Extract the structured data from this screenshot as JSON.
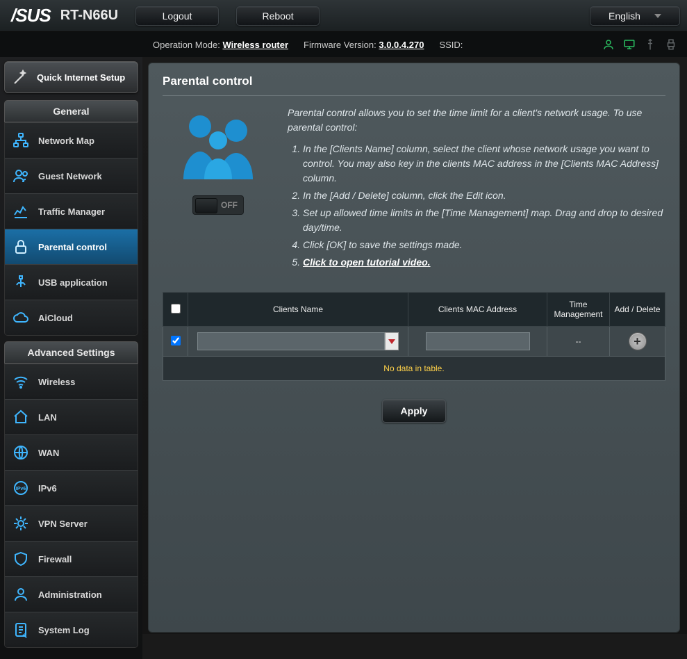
{
  "header": {
    "brand": "/SUS",
    "model": "RT-N66U",
    "logout": "Logout",
    "reboot": "Reboot",
    "language": "English"
  },
  "statusbar": {
    "opmode_label": "Operation Mode:",
    "opmode_value": "Wireless router",
    "fw_label": "Firmware Version:",
    "fw_value": "3.0.0.4.270",
    "ssid_label": "SSID:"
  },
  "sidebar": {
    "qis": "Quick Internet Setup",
    "general_header": "General",
    "general_items": [
      {
        "label": "Network Map",
        "icon": "network-map"
      },
      {
        "label": "Guest Network",
        "icon": "guest"
      },
      {
        "label": "Traffic Manager",
        "icon": "traffic"
      },
      {
        "label": "Parental control",
        "icon": "lock",
        "active": true
      },
      {
        "label": "USB application",
        "icon": "usb"
      },
      {
        "label": "AiCloud",
        "icon": "cloud"
      }
    ],
    "advanced_header": "Advanced Settings",
    "advanced_items": [
      {
        "label": "Wireless",
        "icon": "wifi"
      },
      {
        "label": "LAN",
        "icon": "home"
      },
      {
        "label": "WAN",
        "icon": "globe"
      },
      {
        "label": "IPv6",
        "icon": "ipv6"
      },
      {
        "label": "VPN Server",
        "icon": "vpn"
      },
      {
        "label": "Firewall",
        "icon": "shield"
      },
      {
        "label": "Administration",
        "icon": "admin"
      },
      {
        "label": "System Log",
        "icon": "log"
      }
    ]
  },
  "panel": {
    "title": "Parental control",
    "lead": "Parental control allows you to set the time limit for a client's network usage. To use parental control:",
    "switch_label": "OFF",
    "steps": [
      "In the [Clients Name] column, select the client whose network usage you want to control. You may also key in the clients MAC address in the [Clients MAC Address] column.",
      "In the [Add / Delete] column, click the Edit icon.",
      "Set up allowed time limits in the [Time Management] map. Drag and drop to desired day/time.",
      "Click [OK] to save the settings made."
    ],
    "tutorial_link": "Click to open tutorial video.",
    "table": {
      "col_name": "Clients Name",
      "col_mac": "Clients MAC Address",
      "col_time": "Time Management",
      "col_add": "Add / Delete",
      "time_placeholder": "--",
      "no_data": "No data in table."
    },
    "apply": "Apply"
  }
}
